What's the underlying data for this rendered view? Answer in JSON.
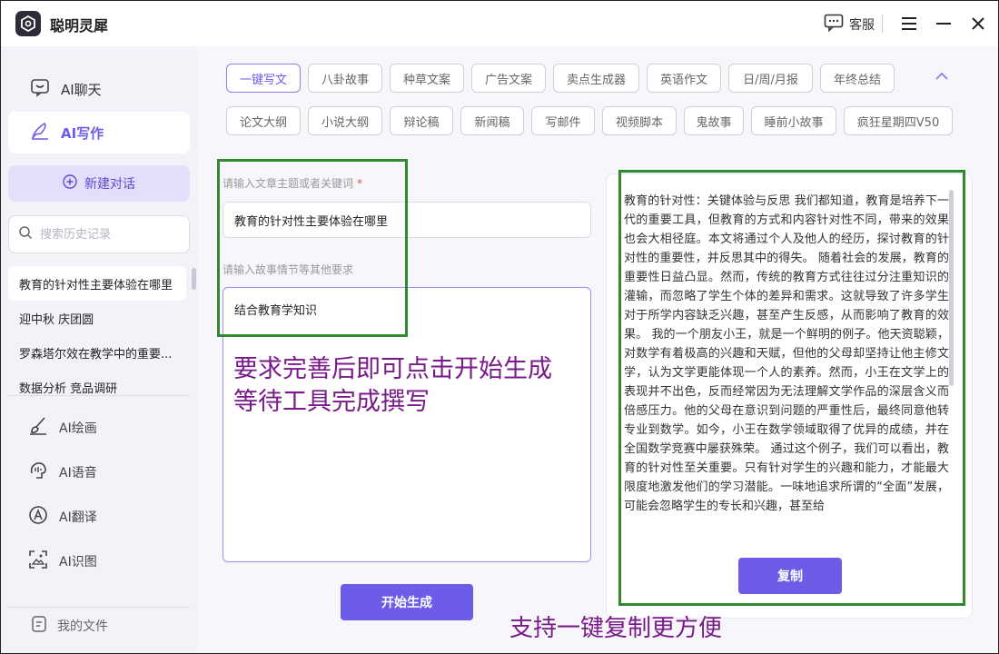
{
  "app": {
    "title": "聪明灵犀"
  },
  "titlebar": {
    "service_label": "客服"
  },
  "sidebar": {
    "nav": [
      {
        "label": "AI聊天",
        "icon": "chat-icon"
      },
      {
        "label": "AI写作",
        "icon": "pen-icon",
        "active": true
      }
    ],
    "new_chat_label": "新建对话",
    "search_placeholder": "搜索历史记录",
    "history": [
      "教育的针对性主要体验在哪里",
      "迎中秋 庆团圆",
      "罗森塔尔效在教学中的重要...",
      "数据分析 竞品调研"
    ],
    "tools": [
      {
        "label": "AI绘画",
        "icon": "brush-icon"
      },
      {
        "label": "AI语音",
        "icon": "voice-icon"
      },
      {
        "label": "AI翻译",
        "icon": "translate-icon"
      },
      {
        "label": "AI识图",
        "icon": "scan-image-icon"
      }
    ],
    "my_files_label": "我的文件"
  },
  "tags_row1": [
    "一键写文",
    "八卦故事",
    "种草文案",
    "广告文案",
    "卖点生成器",
    "英语作文",
    "日/周/月报",
    "年终总结"
  ],
  "tags_row2": [
    "论文大纲",
    "小说大纲",
    "辩论稿",
    "新闻稿",
    "写邮件",
    "视频脚本",
    "鬼故事",
    "睡前小故事",
    "疯狂星期四V50"
  ],
  "form": {
    "topic_label": "请输入文章主题或者关键词",
    "topic_required": "*",
    "topic_value": "教育的针对性主要体验在哪里",
    "plot_label": "请输入故事情节等其他要求",
    "plot_value": "结合教育学知识",
    "start_label": "开始生成"
  },
  "annotations": {
    "line1": "要求完善后即可点击开始生成",
    "line2": "等待工具完成撰写",
    "bottom": "支持一键复制更方便"
  },
  "output": {
    "text": "教育的针对性：关键体验与反思 我们都知道，教育是培养下一代的重要工具，但教育的方式和内容针对性不同，带来的效果也会大相径庭。本文将通过个人及他人的经历，探讨教育的针对性的重要性，并反思其中的得失。 随着社会的发展，教育的重要性日益凸显。然而，传统的教育方式往往过分注重知识的灌输，而忽略了学生个体的差异和需求。这就导致了许多学生对于所学内容缺乏兴趣，甚至产生反感，从而影响了教育的效果。 我的一个朋友小王，就是一个鲜明的例子。他天资聪颖，对数学有着极高的兴趣和天赋，但他的父母却坚持让他主修文学，认为文学更能体现一个人的素养。然而，小王在文学上的表现并不出色，反而经常因为无法理解文学作品的深层含义而倍感压力。他的父母在意识到问题的严重性后，最终同意他转专业到数学。如今，小王在数学领域取得了优异的成绩，并在全国数学竞赛中屡获殊荣。 通过这个例子，我们可以看出，教育的针对性至关重要。只有针对学生的兴趣和能力，才能最大限度地激发他们的学习潜能。一味地追求所谓的“全面”发展，可能会忽略学生的专长和兴趣，甚至给",
    "copy_label": "复制"
  },
  "colors": {
    "accent": "#6c5ce7",
    "annotation_green": "#2e8b2e",
    "annotation_purple": "#7a1a8a"
  }
}
